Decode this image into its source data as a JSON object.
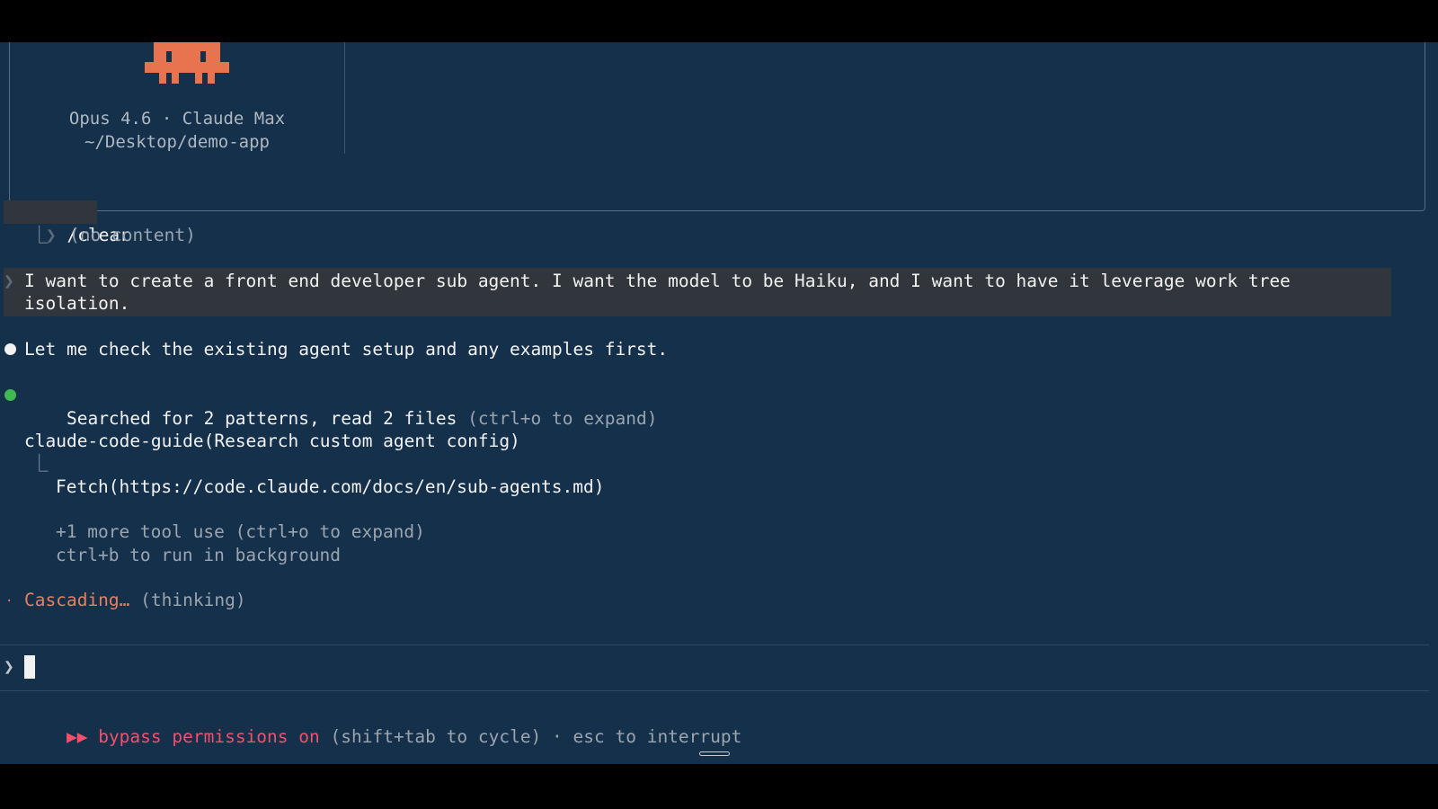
{
  "header": {
    "model_line": "Opus 4.6 · Claude Max",
    "path_line": "~/Desktop/demo-app",
    "mascot_color": "#e8744f"
  },
  "transcript": {
    "clear_cmd": "/clear",
    "clear_result": "(no content)",
    "user_message_1": "I want to create a front end developer sub agent. I want the model to be Haiku, and I want to have it leverage work tree",
    "user_message_2": "isolation.",
    "assistant_msg": "Let me check the existing agent setup and any examples first.",
    "search_summary": "Searched for 2 patterns, read 2 files",
    "search_hint": "(ctrl+o to expand)",
    "tool_name": "claude-code-guide",
    "tool_args": "(Research custom agent config)",
    "fetch_name": "Fetch",
    "fetch_args": "(https://code.claude.com/docs/en/sub-agents.md)",
    "more_tools": "+1 more tool use (ctrl+o to expand)",
    "background_hint": "ctrl+b to run in background",
    "status_word": "Cascading…",
    "status_detail": "(thinking)"
  },
  "footer": {
    "mode_icon": "▶▶",
    "mode_label": "bypass permissions on",
    "mode_hint": "(shift+tab to cycle) · esc to interrupt"
  },
  "colors": {
    "terminal_bg": "#14304a",
    "accent_orange": "#e8805e",
    "accent_pink": "#f0506e",
    "success_green": "#3fb950"
  }
}
